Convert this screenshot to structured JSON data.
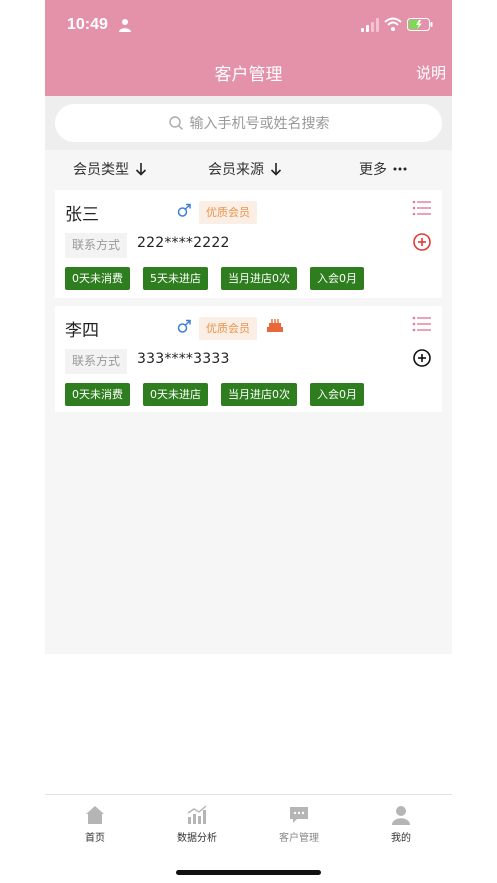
{
  "status_bar": {
    "time": "10:49"
  },
  "header": {
    "title": "客户管理",
    "help_label": "说明"
  },
  "search": {
    "placeholder": "输入手机号或姓名搜索"
  },
  "filters": {
    "member_type": "会员类型",
    "member_source": "会员来源",
    "more": "更多"
  },
  "customers": [
    {
      "name": "张三",
      "level": "优质会员",
      "contact_label": "联系方式",
      "phone": "222****2222",
      "add_icon_color": "#e53935",
      "tags": [
        "0天未消费",
        "5天未进店",
        "当月进店0次",
        "入会0月"
      ]
    },
    {
      "name": "李四",
      "level": "优质会员",
      "contact_label": "联系方式",
      "phone": "333****3333",
      "add_icon_color": "#111111",
      "tags": [
        "0天未消费",
        "0天未进店",
        "当月进店0次",
        "入会0月"
      ]
    }
  ],
  "tabbar": [
    {
      "label": "首页",
      "icon": "home-icon"
    },
    {
      "label": "数据分析",
      "icon": "chart-icon"
    },
    {
      "label": "客户管理",
      "icon": "chat-icon",
      "active": true
    },
    {
      "label": "我的",
      "icon": "user-icon"
    }
  ],
  "colors": {
    "header_bg": "#e392aa",
    "tag_green": "#2e7d1f",
    "badge_text": "#e8944d",
    "badge_bg": "#fbeee4",
    "list_icon": "#e57a9a"
  }
}
